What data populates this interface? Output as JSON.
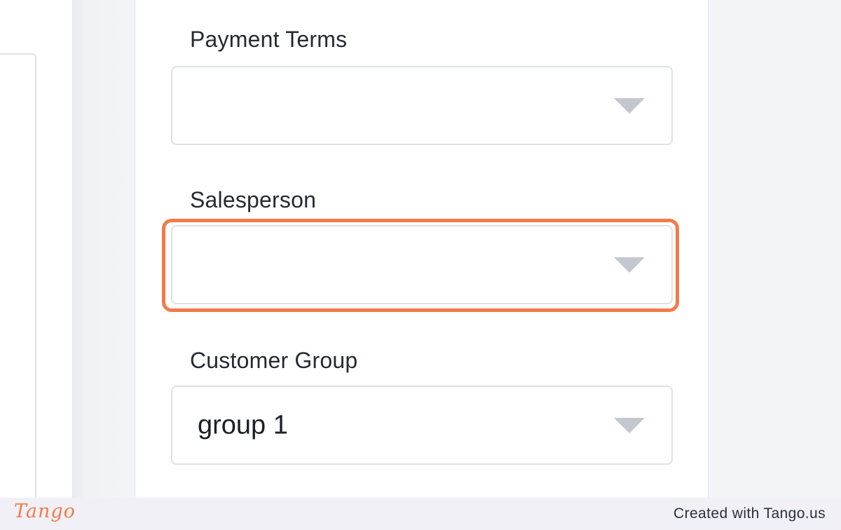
{
  "form": {
    "fields": [
      {
        "label": "Payment Terms",
        "value": ""
      },
      {
        "label": "Salesperson",
        "value": ""
      },
      {
        "label": "Customer Group",
        "value": "group 1"
      }
    ]
  },
  "highlight": {
    "target": "Salesperson",
    "color": "#f47a47"
  },
  "footer": {
    "logo": "Tango",
    "credit": "Created with Tango.us"
  },
  "icons": {
    "dropdown": "chevron-down-icon"
  }
}
